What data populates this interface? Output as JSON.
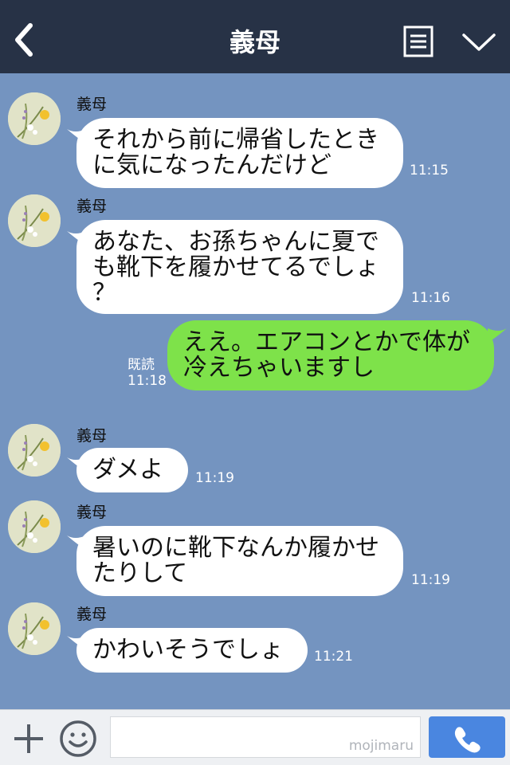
{
  "header": {
    "title": "義母",
    "back_icon": "back-chevron-icon",
    "menu_icon": "menu-icon",
    "dropdown_icon": "chevron-down-icon",
    "bg_color": "#273246"
  },
  "chat": {
    "bg_color": "#7494c0",
    "messages": [
      {
        "sender": "義母",
        "line1": "それから前に帰省したとき",
        "line2": "に気になったんだけど",
        "time": "11:15"
      },
      {
        "sender": "義母",
        "line1": "あなた、お孫ちゃんに夏で",
        "line2": "も靴下を履かせてるでしょ",
        "line3": "？",
        "time": "11:16"
      },
      {
        "read": "既読",
        "read_time": "11:18",
        "line1": "ええ。エアコンとかで体が",
        "line2": "冷えちゃいますし"
      },
      {
        "sender": "義母",
        "line1": "ダメよ",
        "time": "11:19"
      },
      {
        "sender": "義母",
        "line1": "暑いのに靴下なんか履かせ",
        "line2": "たりして",
        "time": "11:19"
      },
      {
        "sender": "義母",
        "line1": "かわいそうでしょ",
        "time": "11:21"
      }
    ]
  },
  "bottom_bar": {
    "plus_icon": "plus-icon",
    "emoji_icon": "emoji-icon",
    "input_value": "",
    "watermark": "mojimaru",
    "call_icon": "phone-icon",
    "call_color": "#4a86e0"
  }
}
